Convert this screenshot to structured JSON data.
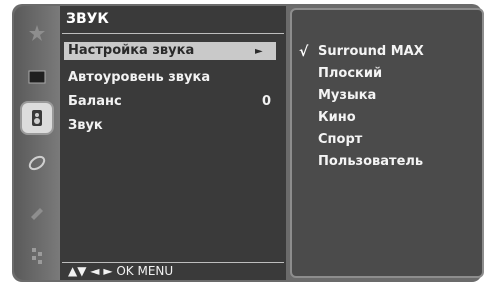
{
  "sidebar": {
    "icons": [
      "star-icon",
      "picture-icon",
      "sound-icon",
      "time-icon",
      "option-icon",
      "settings-icon"
    ]
  },
  "menu": {
    "title": "ЗВУК",
    "items": [
      {
        "label": "Настройка звука",
        "arrow": "►"
      },
      {
        "label": "Автоуровень звука"
      },
      {
        "label": "Баланс",
        "value": "0"
      },
      {
        "label": "Звук"
      }
    ],
    "help": "▲▼ ◄ ► OK MENU"
  },
  "submenu": {
    "checkmark": "√",
    "options": [
      "Surround MAX",
      "Плоский",
      "Музыка",
      "Кино",
      "Спорт",
      "Пользователь"
    ]
  }
}
